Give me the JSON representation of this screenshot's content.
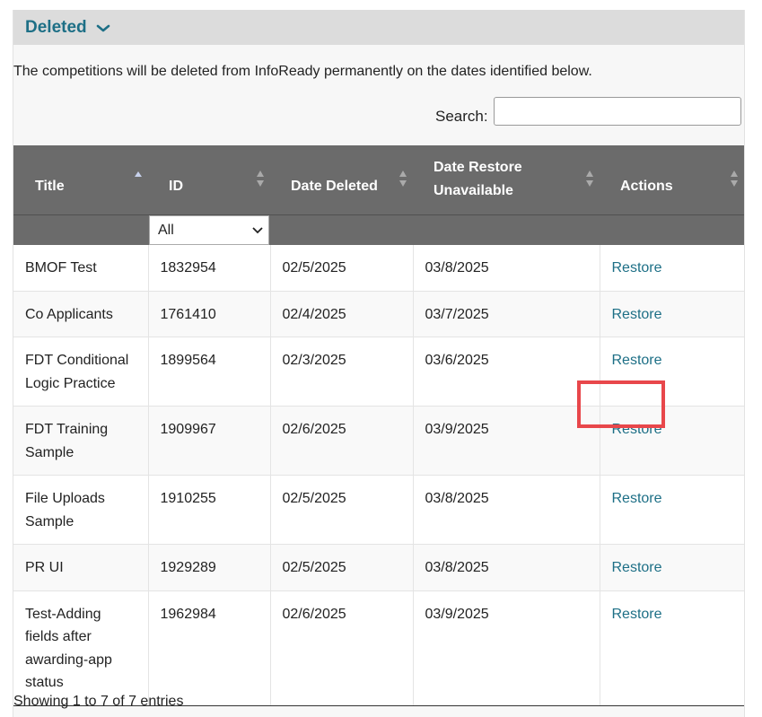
{
  "section": {
    "title": "Deleted"
  },
  "intro_text": "The competitions will be deleted from InfoReady permanently on the dates identified below.",
  "search": {
    "label": "Search:",
    "value": "",
    "placeholder": ""
  },
  "columns": [
    {
      "label": "Title",
      "sort": "asc"
    },
    {
      "label": "ID",
      "sort": "none"
    },
    {
      "label": "Date Deleted",
      "sort": "none"
    },
    {
      "label": "Date Restore Unavailable",
      "sort": "none"
    },
    {
      "label": "Actions",
      "sort": "none"
    }
  ],
  "id_filter": {
    "selected": "All"
  },
  "rows": [
    {
      "title": "BMOF Test",
      "id": "1832954",
      "date_deleted": "02/5/2025",
      "date_unavailable": "03/8/2025",
      "action": "Restore"
    },
    {
      "title": "Co Applicants",
      "id": "1761410",
      "date_deleted": "02/4/2025",
      "date_unavailable": "03/7/2025",
      "action": "Restore"
    },
    {
      "title": "FDT Conditional Logic Practice",
      "id": "1899564",
      "date_deleted": "02/3/2025",
      "date_unavailable": "03/6/2025",
      "action": "Restore"
    },
    {
      "title": "FDT Training Sample",
      "id": "1909967",
      "date_deleted": "02/6/2025",
      "date_unavailable": "03/9/2025",
      "action": "Restore"
    },
    {
      "title": "File Uploads Sample",
      "id": "1910255",
      "date_deleted": "02/5/2025",
      "date_unavailable": "03/8/2025",
      "action": "Restore"
    },
    {
      "title": "PR UI",
      "id": "1929289",
      "date_deleted": "02/5/2025",
      "date_unavailable": "03/8/2025",
      "action": "Restore"
    },
    {
      "title": "Test-Adding fields after awarding-app status",
      "id": "1962984",
      "date_deleted": "02/6/2025",
      "date_unavailable": "03/9/2025",
      "action": "Restore"
    }
  ],
  "footer": {
    "info": "Showing 1 to 7 of 7 entries"
  },
  "colors": {
    "accent": "#1d6f86",
    "header_bg": "#6b6b6b",
    "highlight": "#e8474b"
  }
}
